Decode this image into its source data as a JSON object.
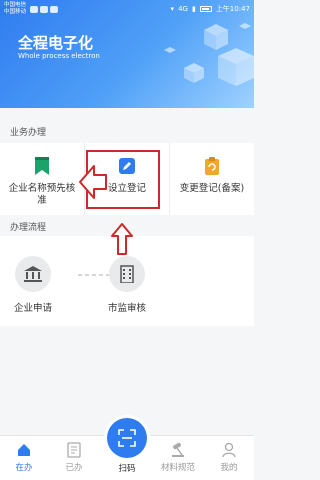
{
  "status_bar": {
    "carrier_line1": "中国电信",
    "carrier_line2": "中国移动",
    "network": "4G",
    "time": "上午10:47"
  },
  "header": {
    "title": "全程电子化",
    "subtitle": "Whole process electron"
  },
  "business": {
    "section_title": "业务办理",
    "items": [
      {
        "label": "企业名称预先核准",
        "icon": "bookmark-icon",
        "color": "#1aa36b"
      },
      {
        "label": "设立登记",
        "icon": "edit-note-icon",
        "color": "#2f7bf0"
      },
      {
        "label": "变更登记(备案)",
        "icon": "change-record-icon",
        "color": "#f2a72b"
      }
    ]
  },
  "process": {
    "section_title": "办理流程",
    "steps": [
      {
        "label": "企业申请",
        "icon": "bank-icon"
      },
      {
        "label": "市监审核",
        "icon": "building-icon"
      }
    ]
  },
  "tabbar": {
    "tabs": [
      {
        "label": "在办",
        "icon": "home-icon",
        "active": true
      },
      {
        "label": "已办",
        "icon": "document-icon",
        "active": false
      },
      {
        "label": "扫码",
        "icon": "scan-icon",
        "active": false
      },
      {
        "label": "材料规范",
        "icon": "gavel-icon",
        "active": false
      },
      {
        "label": "我的",
        "icon": "user-icon",
        "active": false
      }
    ]
  },
  "colors": {
    "primary": "#2f7bf0",
    "annotation": "#d02828"
  }
}
